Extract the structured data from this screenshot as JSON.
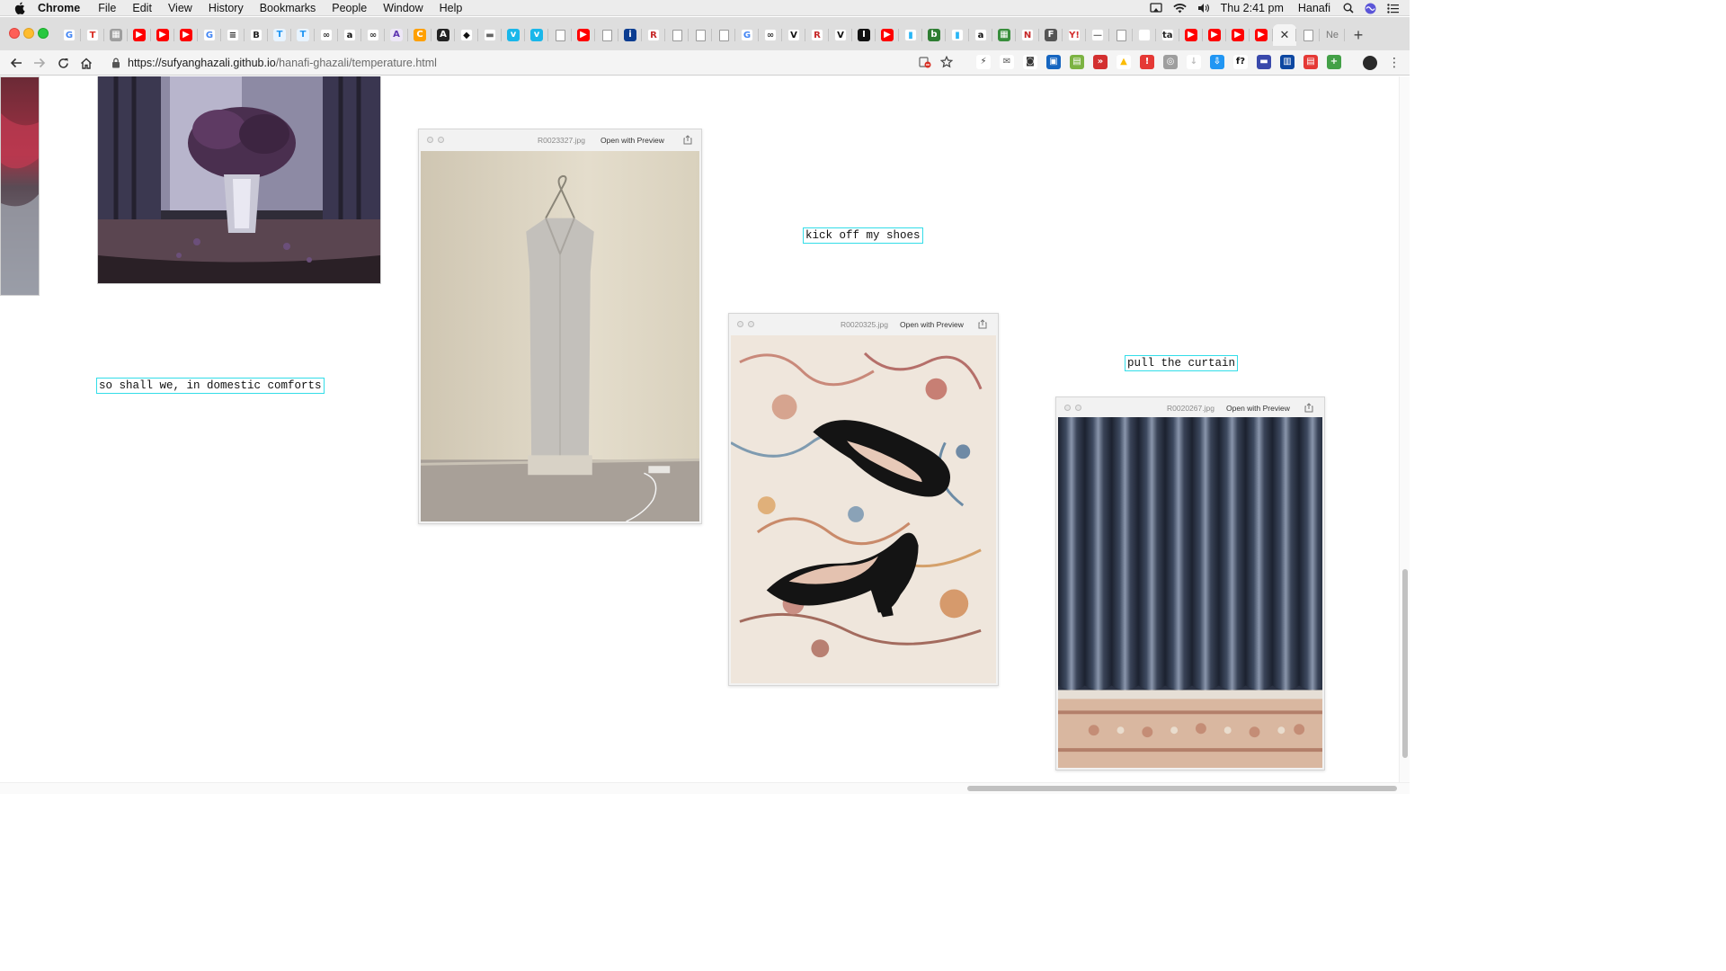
{
  "menubar": {
    "app_name": "Chrome",
    "items": [
      "File",
      "Edit",
      "View",
      "History",
      "Bookmarks",
      "People",
      "Window",
      "Help"
    ],
    "clock": "Thu 2:41 pm",
    "user": "Hanafi"
  },
  "tabs": {
    "favicons": [
      {
        "glyph": "G",
        "color": "#ffffff",
        "fg": "#4285f4"
      },
      {
        "glyph": "T",
        "color": "#ffffff",
        "fg": "#d93025"
      },
      {
        "glyph": "▦",
        "color": "#9e9e9e",
        "fg": "#ffffff"
      },
      {
        "glyph": "▶",
        "color": "#ff0000",
        "fg": "#ffffff"
      },
      {
        "glyph": "▶",
        "color": "#ff0000",
        "fg": "#ffffff"
      },
      {
        "glyph": "▶",
        "color": "#ff0000",
        "fg": "#ffffff"
      },
      {
        "glyph": "G",
        "color": "#ffffff",
        "fg": "#4285f4"
      },
      {
        "glyph": "≡",
        "color": "#ffffff",
        "fg": "#222222"
      },
      {
        "glyph": "B",
        "color": "#ffffff",
        "fg": "#222222"
      },
      {
        "glyph": "T",
        "color": "#e8f4ff",
        "fg": "#2196f3"
      },
      {
        "glyph": "T",
        "color": "#e8f4ff",
        "fg": "#2196f3"
      },
      {
        "glyph": "∞",
        "color": "#ffffff",
        "fg": "#333333"
      },
      {
        "glyph": "a",
        "color": "#ffffff",
        "fg": "#111111"
      },
      {
        "glyph": "∞",
        "color": "#ffffff",
        "fg": "#333333"
      },
      {
        "glyph": "A",
        "color": "#ede7f6",
        "fg": "#5e35b1"
      },
      {
        "glyph": "C",
        "color": "#ffa000",
        "fg": "#ffffff"
      },
      {
        "glyph": "A",
        "color": "#222222",
        "fg": "#ffffff"
      },
      {
        "glyph": "◆",
        "color": "#ffffff",
        "fg": "#111111"
      },
      {
        "glyph": "▬",
        "color": "#ffffff",
        "fg": "#666666"
      },
      {
        "glyph": "v",
        "color": "#1ab7ea",
        "fg": "#ffffff"
      },
      {
        "glyph": "v",
        "color": "#1ab7ea",
        "fg": "#ffffff"
      },
      {
        "glyph": "",
        "color": "doc",
        "fg": "#999999"
      },
      {
        "glyph": "▶",
        "color": "#ff0000",
        "fg": "#ffffff"
      },
      {
        "glyph": "",
        "color": "doc",
        "fg": "#999999"
      },
      {
        "glyph": "i",
        "color": "#0b3d91",
        "fg": "#ffffff"
      },
      {
        "glyph": "R",
        "color": "#ffffff",
        "fg": "#c62828"
      },
      {
        "glyph": "",
        "color": "doc",
        "fg": "#999999"
      },
      {
        "glyph": "",
        "color": "doc",
        "fg": "#999999"
      },
      {
        "glyph": "",
        "color": "doc",
        "fg": "#999999"
      },
      {
        "glyph": "G",
        "color": "#ffffff",
        "fg": "#4285f4"
      },
      {
        "glyph": "∞",
        "color": "#ffffff",
        "fg": "#333333"
      },
      {
        "glyph": "V",
        "color": "#ffffff",
        "fg": "#111111"
      },
      {
        "glyph": "R",
        "color": "#ffffff",
        "fg": "#c62828"
      },
      {
        "glyph": "V",
        "color": "#ffffff",
        "fg": "#111111"
      },
      {
        "glyph": "I",
        "color": "#111111",
        "fg": "#ffffff"
      },
      {
        "glyph": "▶",
        "color": "#ff0000",
        "fg": "#ffffff"
      },
      {
        "glyph": "▮",
        "color": "#ffffff",
        "fg": "#29b6f6"
      },
      {
        "glyph": "b",
        "color": "#2e7d32",
        "fg": "#ffffff"
      },
      {
        "glyph": "▮",
        "color": "#ffffff",
        "fg": "#29b6f6"
      },
      {
        "glyph": "a",
        "color": "#ffffff",
        "fg": "#111111"
      },
      {
        "glyph": "▦",
        "color": "#388e3c",
        "fg": "#ffffff"
      },
      {
        "glyph": "N",
        "color": "#ffffff",
        "fg": "#c62828"
      },
      {
        "glyph": "F",
        "color": "#555555",
        "fg": "#ffffff"
      },
      {
        "glyph": "Y!",
        "color": "#ffffff",
        "fg": "#d32f2f"
      },
      {
        "glyph": "—",
        "color": "#ffffff",
        "fg": "#777777"
      },
      {
        "glyph": "",
        "color": "doc",
        "fg": "#999999"
      },
      {
        "glyph": "",
        "color": "#ffffff",
        "fg": "#ffffff"
      },
      {
        "glyph": "tap",
        "color": "#ffffff",
        "fg": "#222222"
      },
      {
        "glyph": "▶",
        "color": "#ff0000",
        "fg": "#ffffff"
      },
      {
        "glyph": "▶",
        "color": "#ff0000",
        "fg": "#ffffff"
      },
      {
        "glyph": "▶",
        "color": "#ff0000",
        "fg": "#ffffff"
      },
      {
        "glyph": "▶",
        "color": "#ff0000",
        "fg": "#ffffff"
      }
    ],
    "active_close_glyph": "✕",
    "last_tab_label": "Ne",
    "new_tab_glyph": "+"
  },
  "toolbar": {
    "url_host": "https://sufyanghazali.github.io",
    "url_path": "/hanafi-ghazali/temperature.html"
  },
  "extensions": [
    {
      "glyph": "⚡",
      "color": "#ffffff",
      "fg": "#333333"
    },
    {
      "glyph": "✉",
      "color": "#ffffff",
      "fg": "#555555"
    },
    {
      "glyph": "◙",
      "color": "#ffffff",
      "fg": "#333333"
    },
    {
      "glyph": "▣",
      "color": "#1565c0",
      "fg": "#ffffff"
    },
    {
      "glyph": "▤",
      "color": "#7cb342",
      "fg": "#ffffff"
    },
    {
      "glyph": "»",
      "color": "#d32f2f",
      "fg": "#ffffff"
    },
    {
      "glyph": "▲",
      "color": "#ffffff",
      "fg": "#fbbc04"
    },
    {
      "glyph": "!",
      "color": "#e53935",
      "fg": "#ffffff"
    },
    {
      "glyph": "◎",
      "color": "#9e9e9e",
      "fg": "#ffffff"
    },
    {
      "glyph": "↓",
      "color": "#ffffff",
      "fg": "#bbbbbb"
    },
    {
      "glyph": "⇩",
      "color": "#2196f3",
      "fg": "#ffffff"
    },
    {
      "glyph": "f?",
      "color": "#ffffff",
      "fg": "#111111"
    },
    {
      "glyph": "▬",
      "color": "#3949ab",
      "fg": "#ffffff"
    },
    {
      "glyph": "▥",
      "color": "#0d47a1",
      "fg": "#ffffff"
    },
    {
      "glyph": "▤",
      "color": "#e53935",
      "fg": "#ffffff"
    },
    {
      "glyph": "+",
      "color": "#43a047",
      "fg": "#ffffff"
    }
  ],
  "page": {
    "captions": [
      "so shall we, in domestic comforts",
      "kick off my shoes",
      "pull the curtain"
    ],
    "preview_windows": [
      {
        "filename": "R0023327.jpg",
        "open_with": "Open with Preview",
        "photo": "dress"
      },
      {
        "filename": "R0020325.jpg",
        "open_with": "Open with Preview",
        "photo": "shoes"
      },
      {
        "filename": "R0020267.jpg",
        "open_with": "Open with Preview",
        "photo": "curtain"
      }
    ]
  },
  "colors": {
    "caption_border": "#33dde8",
    "page_background": "#ffffff"
  }
}
